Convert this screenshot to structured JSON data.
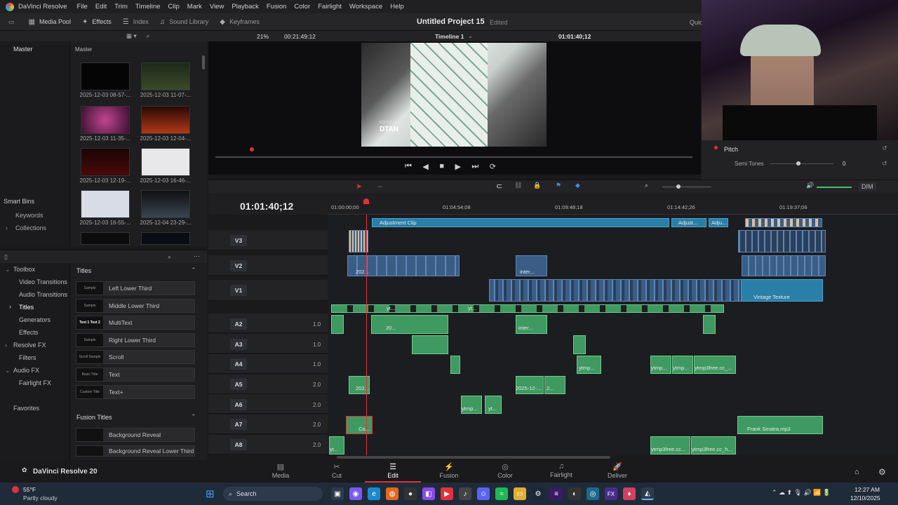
{
  "app_name": "DaVinci Resolve",
  "menu": [
    "File",
    "Edit",
    "Trim",
    "Timeline",
    "Clip",
    "Mark",
    "View",
    "Playback",
    "Fusion",
    "Color",
    "Fairlight",
    "Workspace",
    "Help"
  ],
  "toolbar": {
    "media_pool": "Media Pool",
    "effects": "Effects",
    "index": "Index",
    "sound_library": "Sound Library",
    "keyframes": "Keyframes",
    "project_title": "Untitled Project 15",
    "project_status": "Edited",
    "quick_export": "Quick Expo"
  },
  "viewer_bar": {
    "zoom": "21%",
    "source_tc": "00:21:49:12",
    "timeline_name": "Timeline 1",
    "timecode": "01:01:40;12"
  },
  "media_pool": {
    "left_label": "Master",
    "right_label": "Master",
    "clips": [
      "2025-12-03 08-57-...",
      "2025-12-03 11-07-...",
      "2025-12-03 11-35-...",
      "2025-12-03 12-04-...",
      "2025-12-03 12-19-...",
      "2025-12-03 16-46-...",
      "2025-12-03 16-55-...",
      "2025-12-04 23-29-..."
    ],
    "smart_bins": "Smart Bins",
    "keywords": "Keywords",
    "collections": "Collections"
  },
  "effects": {
    "toolbox": "Toolbox",
    "video_transitions": "Video Transitions",
    "audio_transitions": "Audio Transitions",
    "titles": "Titles",
    "generators": "Generators",
    "effects": "Effects",
    "resolve_fx": "Resolve FX",
    "filters": "Filters",
    "audio_fx": "Audio FX",
    "fairlight_fx": "Fairlight FX",
    "favorites": "Favorites",
    "titles_header": "Titles",
    "title_items": [
      "Left Lower Third",
      "Middle Lower Third",
      "MultiText",
      "Right Lower Third",
      "Scroll",
      "Text",
      "Text+"
    ],
    "title_thumbs": [
      "Sample",
      "Sample",
      "Text 1 Text 2",
      "Sample",
      "Scroll Sample",
      "Basic Title",
      "Custom Title"
    ],
    "fusion_titles": "Fusion Titles",
    "fusion_items": [
      "Background Reveal",
      "Background Reveal Lower Third"
    ]
  },
  "viewer": {
    "watermark": "DTAN",
    "watermark_small": "EDITED BY"
  },
  "inspector": {
    "pitch": "Pitch",
    "semi_tones": "Semi Tones",
    "semi_value": "0"
  },
  "timeline": {
    "timecode": "01:01:40;12",
    "ruler": [
      "01:00:00;00",
      "01:04:54;08",
      "01:09:48;18",
      "01:14:42;26",
      "01:19:37;06"
    ],
    "dim": "DIM",
    "tracks": [
      "V3",
      "V2",
      "V1",
      "A2",
      "A3",
      "A4",
      "A5",
      "A6",
      "A7",
      "A8"
    ],
    "levels": [
      "1.0",
      "1.0",
      "1.0",
      "2.0",
      "2.0",
      "2.0",
      "2.0"
    ],
    "labels": {
      "adjust": "Adjustment Clip",
      "adjust2": "Adjust...",
      "adju": "Adju...",
      "vintage": "Vintage Texture",
      "frank": "Frank Sinatra.mp3",
      "yt1": "yt...",
      "yt2": "yt...",
      "c20": "20...",
      "inter": "inter...",
      "ytmp": "ytmp...",
      "ytmp_a": "ytmp...",
      "ytmp_b": "ytmp...",
      "ytmp3free": "ytmp3free.cc_...",
      "c2025": "2025-12-...",
      "c2": "2...",
      "ytmp_c": "ytmp...",
      "yt3": "yt...",
      "co": "Co...",
      "ytmp3free_b": "ytmp3free.cc...",
      "ytmp3free_c": "ytmp3free.cc_h...",
      "yt4": "yt...",
      "c202": "202...",
      "c202b": "202...",
      "inter2": "inter..."
    }
  },
  "pages": [
    "Media",
    "Cut",
    "Edit",
    "Fusion",
    "Color",
    "Fairlight",
    "Deliver"
  ],
  "brand": "DaVinci Resolve 20",
  "taskbar": {
    "temp": "55°F",
    "weather": "Partly cloudy",
    "search": "Search",
    "time": "12:27 AM",
    "date": "12/10/2025"
  },
  "colors": {
    "accent": "#e0323b",
    "video_clip": "#3a5d86",
    "audio_clip": "#3e9a60",
    "adjust": "#2a7fa8"
  }
}
